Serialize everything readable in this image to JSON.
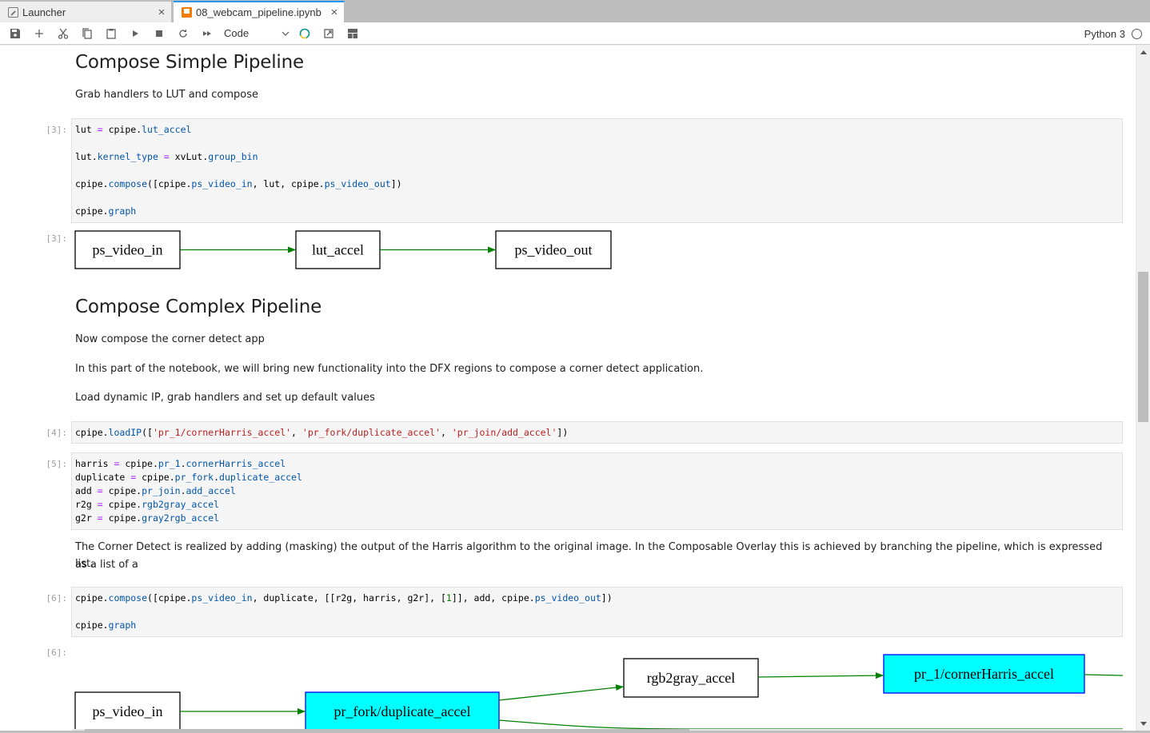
{
  "tabs": [
    {
      "label": "Launcher",
      "icon": "launcher-icon",
      "active": false
    },
    {
      "label": "08_webcam_pipeline.ipynb",
      "icon": "notebook-icon",
      "active": true
    }
  ],
  "toolbar": {
    "buttons": [
      "save-icon",
      "add-cell-icon",
      "cut-icon",
      "copy-icon",
      "paste-icon",
      "run-icon",
      "stop-icon",
      "restart-icon",
      "run-all-icon"
    ],
    "cell_type": "Code",
    "extra_buttons": [
      "busy-indicator-icon",
      "open-external-icon",
      "layout-grid-icon"
    ],
    "kernel_name": "Python 3"
  },
  "cells": {
    "h_simple": "Compose Simple Pipeline",
    "p_simple": "Grab handlers to LUT and compose",
    "c3_prompt": "[3]:",
    "c3_lines": [
      [
        [
          "lut",
          "var"
        ],
        [
          " = ",
          "op"
        ],
        [
          "cpipe.",
          "var"
        ],
        [
          "lut_accel",
          "attr"
        ]
      ],
      [],
      [
        [
          "lut.",
          "var"
        ],
        [
          "kernel_type",
          "attr"
        ],
        [
          " = ",
          "op"
        ],
        [
          "xvLut.",
          "var"
        ],
        [
          "group_bin",
          "attr"
        ]
      ],
      [],
      [
        [
          "cpipe.",
          "var"
        ],
        [
          "compose",
          "attr"
        ],
        [
          "([cpipe.",
          "var"
        ],
        [
          "ps_video_in",
          "attr"
        ],
        [
          ", lut, cpipe.",
          "var"
        ],
        [
          "ps_video_out",
          "attr"
        ],
        [
          "])",
          "var"
        ]
      ],
      [],
      [
        [
          "cpipe.",
          "var"
        ],
        [
          "graph",
          "attr"
        ]
      ]
    ],
    "o3_prompt": "[3]:",
    "h_complex": "Compose Complex Pipeline",
    "p_complex_1": "Now compose the corner detect app",
    "p_complex_2": "In this part of the notebook, we will bring new functionality into the DFX regions to compose a corner detect application.",
    "p_complex_3": "Load dynamic IP, grab handlers and set up default values",
    "c4_prompt": "[4]:",
    "c4_lines": [
      [
        [
          "cpipe.",
          "var"
        ],
        [
          "loadIP",
          "attr"
        ],
        [
          "([",
          "var"
        ],
        [
          "'pr_1/cornerHarris_accel'",
          "str"
        ],
        [
          ", ",
          "var"
        ],
        [
          "'pr_fork/duplicate_accel'",
          "str"
        ],
        [
          ", ",
          "var"
        ],
        [
          "'pr_join/add_accel'",
          "str"
        ],
        [
          "])",
          "var"
        ]
      ]
    ],
    "c5_prompt": "[5]:",
    "c5_lines": [
      [
        [
          "harris",
          "var"
        ],
        [
          " = ",
          "op"
        ],
        [
          "cpipe.",
          "var"
        ],
        [
          "pr_1",
          "attr"
        ],
        [
          ".",
          "var"
        ],
        [
          "cornerHarris_accel",
          "attr"
        ]
      ],
      [
        [
          "duplicate",
          "var"
        ],
        [
          " = ",
          "op"
        ],
        [
          "cpipe.",
          "var"
        ],
        [
          "pr_fork",
          "attr"
        ],
        [
          ".",
          "var"
        ],
        [
          "duplicate_accel",
          "attr"
        ]
      ],
      [
        [
          "add",
          "var"
        ],
        [
          " = ",
          "op"
        ],
        [
          "cpipe.",
          "var"
        ],
        [
          "pr_join",
          "attr"
        ],
        [
          ".",
          "var"
        ],
        [
          "add_accel",
          "attr"
        ]
      ],
      [
        [
          "r2g",
          "var"
        ],
        [
          " = ",
          "op"
        ],
        [
          "cpipe.",
          "var"
        ],
        [
          "rgb2gray_accel",
          "attr"
        ]
      ],
      [
        [
          "g2r",
          "var"
        ],
        [
          " = ",
          "op"
        ],
        [
          "cpipe.",
          "var"
        ],
        [
          "gray2rgb_accel",
          "attr"
        ]
      ]
    ],
    "p_corner_1": "The Corner Detect is realized by adding (masking) the output of the Harris algorithm to the original image. In the Composable Overlay this is achieved by branching the pipeline, which is expressed as a list of a",
    "p_corner_2": "list.",
    "c6_prompt": "[6]:",
    "c6_lines": [
      [
        [
          "cpipe.",
          "var"
        ],
        [
          "compose",
          "attr"
        ],
        [
          "([cpipe.",
          "var"
        ],
        [
          "ps_video_in",
          "attr"
        ],
        [
          ", duplicate, [[r2g, harris, g2r], [",
          "var"
        ],
        [
          "1",
          "num"
        ],
        [
          "]], add, cpipe.",
          "var"
        ],
        [
          "ps_video_out",
          "attr"
        ],
        [
          "])",
          "var"
        ]
      ],
      [],
      [
        [
          "cpipe.",
          "var"
        ],
        [
          "graph",
          "attr"
        ]
      ]
    ],
    "o6_prompt": "[6]:"
  },
  "graph_simple": {
    "nodes": [
      {
        "id": "ps_video_in",
        "label": "ps_video_in",
        "dynamic": false
      },
      {
        "id": "lut_accel",
        "label": "lut_accel",
        "dynamic": false
      },
      {
        "id": "ps_video_out",
        "label": "ps_video_out",
        "dynamic": false
      }
    ],
    "edges": [
      [
        "ps_video_in",
        "lut_accel"
      ],
      [
        "lut_accel",
        "ps_video_out"
      ]
    ]
  },
  "graph_complex": {
    "nodes": [
      {
        "id": "ps_video_in",
        "label": "ps_video_in",
        "dynamic": false
      },
      {
        "id": "pr_fork",
        "label": "pr_fork/duplicate_accel",
        "dynamic": true
      },
      {
        "id": "rgb2gray",
        "label": "rgb2gray_accel",
        "dynamic": false
      },
      {
        "id": "pr_1",
        "label": "pr_1/cornerHarris_accel",
        "dynamic": true
      }
    ],
    "edges": [
      [
        "ps_video_in",
        "pr_fork"
      ],
      [
        "pr_fork",
        "rgb2gray"
      ],
      [
        "rgb2gray",
        "pr_1"
      ]
    ]
  },
  "colors": {
    "edge": "#008000",
    "dynamic_fill": "#00ffff",
    "dynamic_border": "#0000ff",
    "tab_accent": "#2196f3",
    "notebook_icon": "#f57c00"
  }
}
